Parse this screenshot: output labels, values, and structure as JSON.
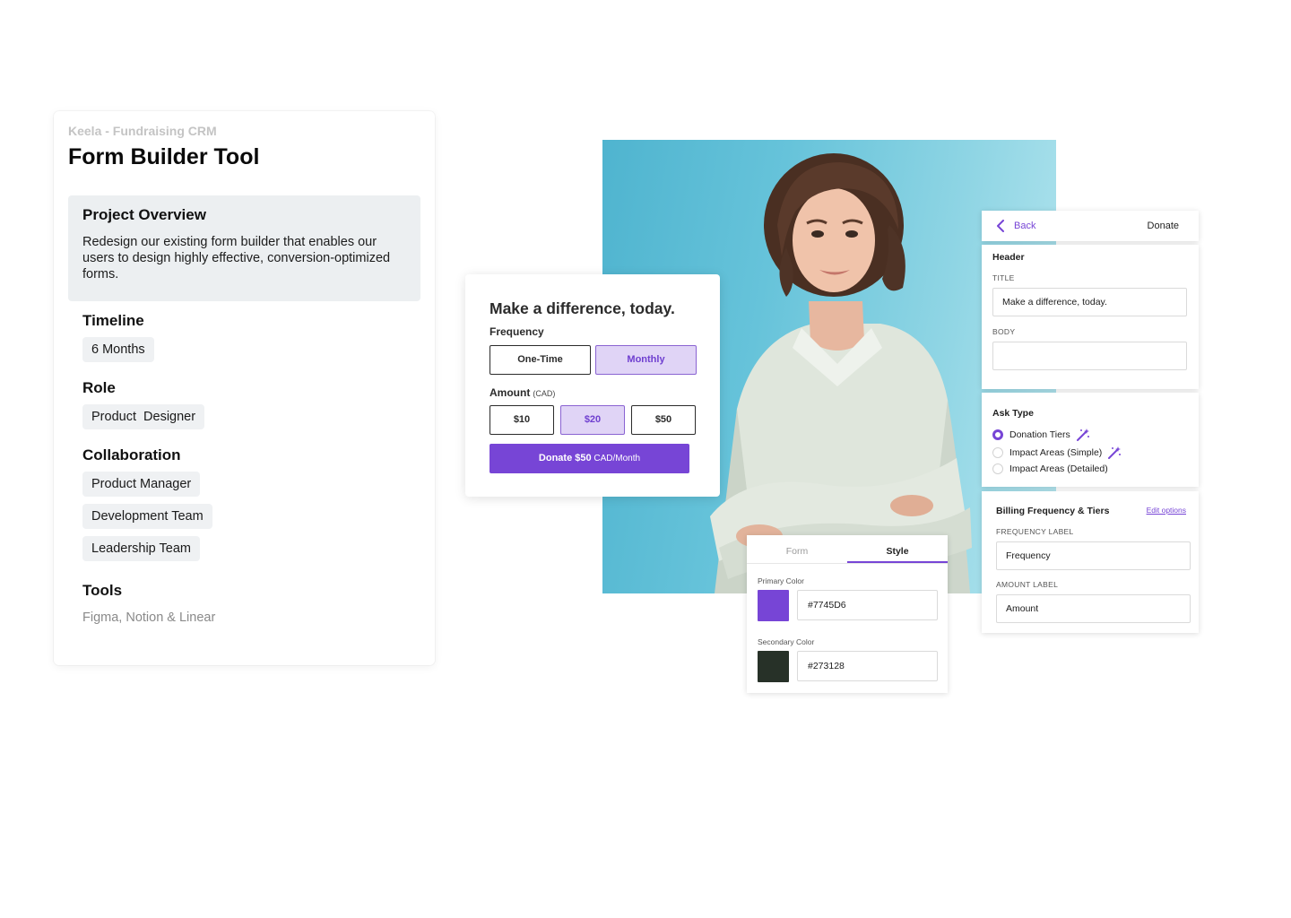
{
  "case_study": {
    "eyebrow": "Keela - Fundraising CRM",
    "title": "Form Builder Tool",
    "overview": {
      "heading": "Project Overview",
      "body": "Redesign our existing form builder that enables our users to design highly effective, conversion-optimized forms."
    },
    "timeline": {
      "heading": "Timeline",
      "value": "6 Months"
    },
    "role": {
      "heading": "Role",
      "value": "Product  Designer"
    },
    "collaboration": {
      "heading": "Collaboration",
      "items": [
        "Product Manager",
        "Development Team",
        "Leadership Team"
      ]
    },
    "tools": {
      "heading": "Tools",
      "value": "Figma, Notion & Linear"
    }
  },
  "donation_form": {
    "title": "Make a difference, today.",
    "frequency_label": "Frequency",
    "frequency_options": [
      "One-Time",
      "Monthly"
    ],
    "frequency_selected": "Monthly",
    "amount_label": "Amount",
    "amount_unit": "(CAD)",
    "amount_options": [
      "$10",
      "$20",
      "$50"
    ],
    "amount_selected": "$20",
    "donate_button": {
      "prefix": "Donate $50",
      "suffix": " CAD/Month"
    }
  },
  "builder": {
    "top": {
      "back": "Back",
      "action": "Donate"
    },
    "header_section": {
      "heading": "Header",
      "title_label": "TITLE",
      "title_value": "Make a difference, today.",
      "body_label": "BODY",
      "body_value": ""
    },
    "ask_type": {
      "heading": "Ask Type",
      "options": [
        "Donation Tiers",
        "Impact Areas (Simple)",
        "Impact Areas (Detailed)"
      ],
      "selected": "Donation Tiers",
      "wand_icon": "magic-wand-icon"
    },
    "billing": {
      "heading": "Billing Frequency & Tiers",
      "edit_link": "Edit options",
      "frequency_label_caption": "FREQUENCY LABEL",
      "frequency_label_value": "Frequency",
      "amount_label_caption": "AMOUNT LABEL",
      "amount_label_value": "Amount"
    }
  },
  "style_panel": {
    "tabs": [
      "Form",
      "Style"
    ],
    "active_tab": "Style",
    "primary_label": "Primary Color",
    "primary_value": "#7745D6",
    "secondary_label": "Secondary Color",
    "secondary_value": "#273128"
  },
  "colors": {
    "accent": "#7745d6",
    "accent_light": "#e0d4f6",
    "secondary": "#273128",
    "photo_bg": "#66c3da"
  }
}
